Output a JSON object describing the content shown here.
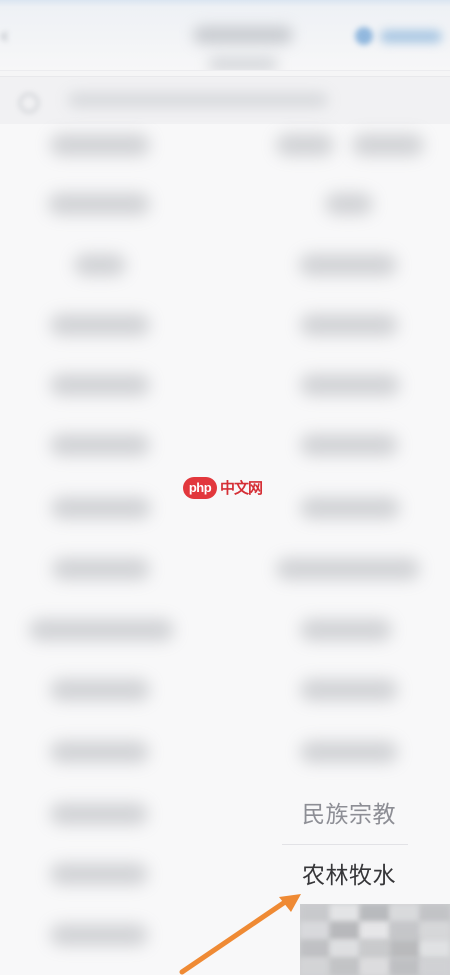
{
  "watermark": {
    "logo_text": "php",
    "site_text": "中文网"
  },
  "popup": {
    "items": [
      {
        "label": "民族宗教",
        "state": "inactive"
      },
      {
        "label": "农林牧水",
        "state": "selected"
      }
    ]
  },
  "colors": {
    "arrow": "#ef8a34",
    "background": "#f8f8f9",
    "selected_text": "#363639",
    "inactive_text": "#8d8e95",
    "watermark_red": "#e2373c"
  },
  "icons": {
    "back": "back-arrow-icon",
    "search": "search-icon",
    "top_action": "location-icon",
    "annotation": "arrow-icon"
  }
}
